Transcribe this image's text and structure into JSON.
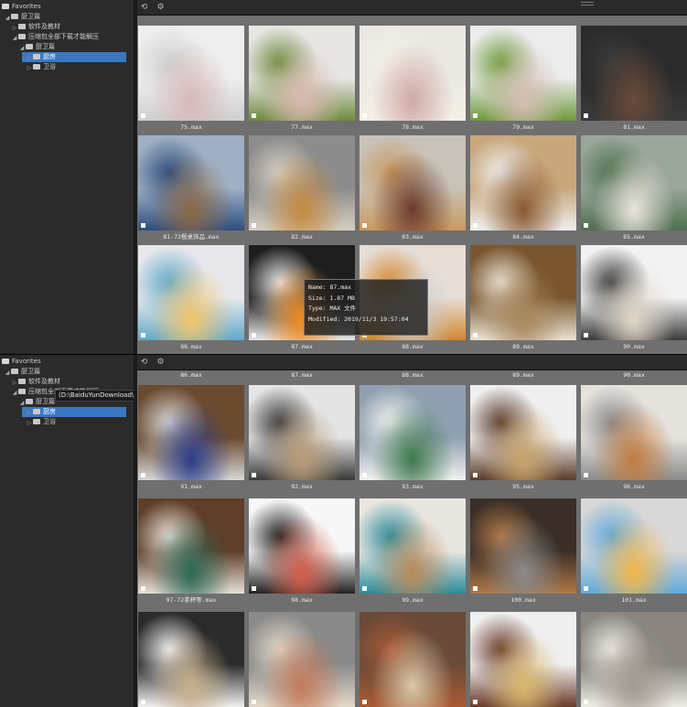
{
  "panels": [
    {
      "tree": {
        "root": "Favorites",
        "items": [
          {
            "label": "厨卫篇",
            "level": 1,
            "expanded": true
          },
          {
            "label": "软件及教材",
            "level": 2
          },
          {
            "label": "压缩包全部下载才能解压",
            "level": 2,
            "expanded": true
          },
          {
            "label": "厨卫篇",
            "level": 3,
            "expanded": true
          },
          {
            "label": "厨房",
            "level": 4,
            "selected": true
          },
          {
            "label": "卫浴",
            "level": 4
          }
        ]
      },
      "thumbs": [
        {
          "caption": "75.max",
          "scene": "cutlery-white"
        },
        {
          "caption": "77.max",
          "scene": "plant-table"
        },
        {
          "caption": "78.max",
          "scene": "flowers-table"
        },
        {
          "caption": "79.max",
          "scene": "green-plant-table"
        },
        {
          "caption": "81.max",
          "scene": "dark-render"
        },
        {
          "caption": "81-72餐桌饰品.max",
          "scene": "blue-dining"
        },
        {
          "caption": "82.max",
          "scene": "top-down-food"
        },
        {
          "caption": "83.max",
          "scene": "bread-board"
        },
        {
          "caption": "84.max",
          "scene": "kitchen-shelf"
        },
        {
          "caption": "85.max",
          "scene": "green-placemat"
        },
        {
          "caption": "86.max",
          "scene": "bowls-bright"
        },
        {
          "caption": "87.max",
          "scene": "tiles-oranges"
        },
        {
          "caption": "88.max",
          "scene": "croissants"
        },
        {
          "caption": "89.max",
          "scene": "plates-wood"
        },
        {
          "caption": "90.max",
          "scene": "eat-wall"
        }
      ],
      "tooltip": {
        "name": "Name: 87.max",
        "size": "Size: 1.87 MB",
        "type": "Type: MAX 文件",
        "modified": "Modified: 2019/11/3 19:57:04"
      }
    },
    {
      "tree": {
        "root": "Favorites",
        "items": [
          {
            "label": "厨卫篇",
            "level": 1,
            "expanded": true
          },
          {
            "label": "软件及教材",
            "level": 2
          },
          {
            "label": "压缩包全部下载才能解压",
            "level": 2,
            "expanded": true
          },
          {
            "label": "厨卫篇",
            "level": 3,
            "expanded": true
          },
          {
            "label": "厨房",
            "level": 4,
            "selected": true
          },
          {
            "label": "卫浴",
            "level": 4
          }
        ],
        "path_tooltip": "(D:\\BaiduYunDownload\\厨卫篇\\压缩包全部下载才能解压\\厨卫篇)"
      },
      "top_captions": [
        "86.max",
        "87.max",
        "88.max",
        "89.max",
        "90.max"
      ],
      "thumbs": [
        {
          "caption": "91.max",
          "scene": "plates-stack"
        },
        {
          "caption": "92.max",
          "scene": "wall-shelves"
        },
        {
          "caption": "93.max",
          "scene": "green-cabinet"
        },
        {
          "caption": "95.max",
          "scene": "brick-kitchen"
        },
        {
          "caption": "96.max",
          "scene": "utensils-wall"
        },
        {
          "caption": "97-72茶杯等.max",
          "scene": "tea-table"
        },
        {
          "caption": "98.max",
          "scene": "sushi"
        },
        {
          "caption": "99.max",
          "scene": "teal-shelf"
        },
        {
          "caption": "100.max",
          "scene": "copper-pots"
        },
        {
          "caption": "101.max",
          "scene": "breakfast-tray"
        },
        {
          "caption": "",
          "scene": "love-board"
        },
        {
          "caption": "",
          "scene": "mixer-grey"
        },
        {
          "caption": "",
          "scene": "pots-wood"
        },
        {
          "caption": "",
          "scene": "jars-shelf"
        },
        {
          "caption": "",
          "scene": "napkin-plate"
        }
      ]
    }
  ],
  "colors": {
    "accent": "#3a78c2",
    "grid_bg": "#6f6f6f",
    "panel_bg": "#2b2b2b"
  }
}
